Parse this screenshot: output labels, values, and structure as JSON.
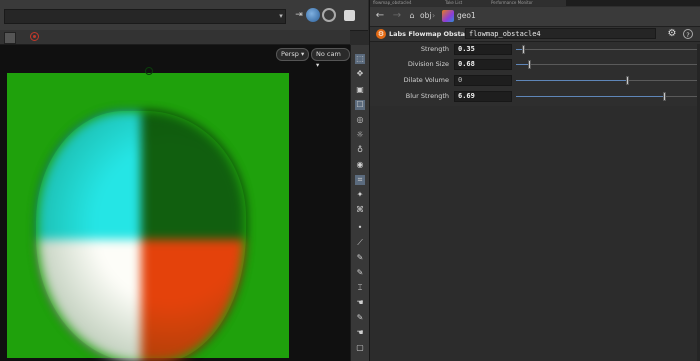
{
  "viewport": {
    "persp_menu": "Persp ▾",
    "camera_menu": "No cam ▾",
    "colors": {
      "background": "#101010",
      "plane": "#1fa10c",
      "quadrant_top_right": "#115f0f",
      "quadrant_bottom_right": "#e4420b",
      "quadrant_bottom_left": "#fdfdf8",
      "quadrant_top_left": "#25e5e5"
    }
  },
  "toolbar": {
    "icons": [
      "pin-icon",
      "globe-icon",
      "settings-icon",
      "grid-icon"
    ]
  },
  "tools": {
    "icons": [
      "select-icon",
      "transform-icon",
      "lock-icon",
      "pose-icon",
      "rotate-icon",
      "handle-icon",
      "light-icon",
      "eye-icon",
      "camera-icon",
      "wand-icon",
      "brush-icon",
      "dot-icon",
      "pen-icon",
      "pencil-icon",
      "pencil-icon",
      "text-icon",
      "hand-icon",
      "pencil-icon",
      "hand-icon",
      "square-icon",
      "arrow-icon"
    ]
  },
  "pane_tabs": [
    "flowmap_obstacle4",
    "Take List",
    "Performance Monitor"
  ],
  "navbar": {
    "crumbs": [
      "obj",
      "geo1"
    ],
    "separator": "›"
  },
  "node": {
    "type_label": "Labs Flowmap Obstacle",
    "name": "flowmap_obstacle4",
    "accent": "#e36a14"
  },
  "params": [
    {
      "label": "Strength",
      "value": "0.35",
      "fraction": 0.04
    },
    {
      "label": "Division Size",
      "value": "0.68",
      "fraction": 0.07
    },
    {
      "label": "Dilate Volume",
      "value": "0",
      "fraction": 0.6
    },
    {
      "label": "Blur Strength",
      "value": "6.69",
      "fraction": 0.8
    }
  ]
}
